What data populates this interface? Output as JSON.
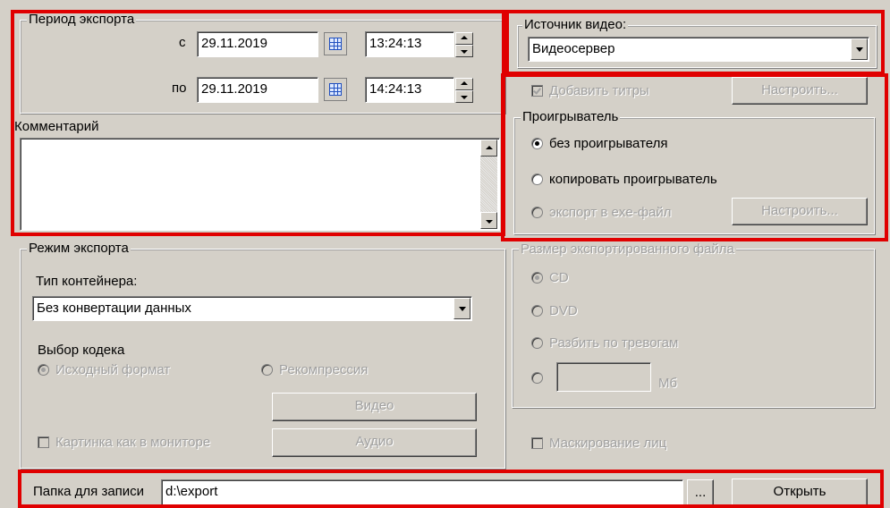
{
  "export_period": {
    "title": "Период экспорта",
    "from_label": "с",
    "from_date": "29.11.2019",
    "from_time": "13:24:13",
    "to_label": "по",
    "to_date": "29.11.2019",
    "to_time": "14:24:13"
  },
  "comment": {
    "label": "Комментарий",
    "value": ""
  },
  "video_source": {
    "title": "Источник видео:",
    "value": "Видеосервер"
  },
  "titles": {
    "label": "Добавить титры",
    "checked": true,
    "configure": "Настроить..."
  },
  "player": {
    "title": "Проигрыватель",
    "options": [
      "без проигрывателя",
      "копировать проигрыватель",
      "экспорт в exe-файл"
    ],
    "selected": 0,
    "configure": "Настроить..."
  },
  "export_mode": {
    "title": "Режим экспорта",
    "container_label": "Тип контейнера:",
    "container_value": "Без конвертации данных",
    "codec_label": "Выбор кодека",
    "codec_options": [
      "Исходный формат",
      "Рекомпрессия"
    ],
    "video_button": "Видео",
    "audio_button": "Аудио",
    "monitor_picture": "Картинка как в мониторе"
  },
  "file_size": {
    "title": "Размер экспортированного файла",
    "options": [
      "CD",
      "DVD",
      "Разбить по тревогам"
    ],
    "custom_value": "",
    "unit": "Мб"
  },
  "face_mask": {
    "label": "Маскирование лиц"
  },
  "folder": {
    "label": "Папка для записи",
    "value": "d:\\export",
    "browse": "...",
    "open": "Открыть"
  },
  "colors": {
    "highlight": "#e00000",
    "background": "#d4d0c8"
  }
}
